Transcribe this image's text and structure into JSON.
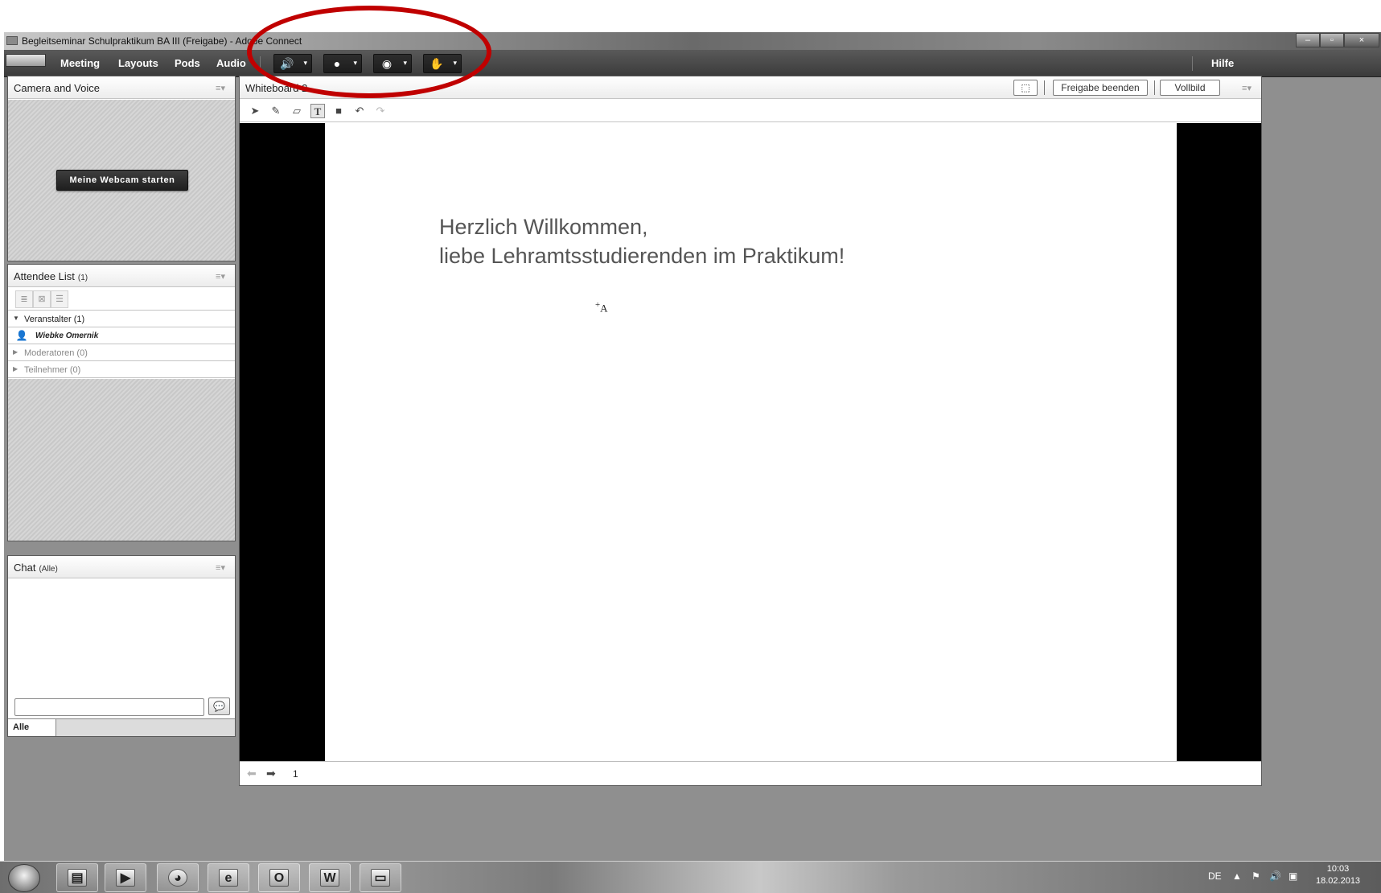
{
  "window": {
    "title": "Begleitseminar Schulpraktikum BA III (Freigabe) - Adobe Connect",
    "controls": [
      "–",
      "▫",
      "×"
    ]
  },
  "menubar": {
    "items": [
      "Meeting",
      "Layouts",
      "Pods",
      "Audio"
    ],
    "help_label": "Hilfe",
    "toolbar_icons": [
      "speaker-icon",
      "microphone-icon",
      "webcam-icon",
      "raise-hand-icon"
    ]
  },
  "camera_pod": {
    "title": "Camera and Voice",
    "start_webcam_label": "Meine Webcam starten"
  },
  "attendee_pod": {
    "title": "Attendee List",
    "count": "(1)",
    "groups": [
      {
        "label": "Veranstalter (1)",
        "expanded": true,
        "members": [
          "Wiebke Omernik"
        ]
      },
      {
        "label": "Moderatoren (0)",
        "expanded": false,
        "members": []
      },
      {
        "label": "Teilnehmer (0)",
        "expanded": false,
        "members": []
      }
    ]
  },
  "chat_pod": {
    "title": "Chat",
    "scope": "(Alle)",
    "input_value": "",
    "tab_label": "Alle"
  },
  "whiteboard_pod": {
    "title": "Whiteboard 2",
    "stop_share_label": "Freigabe beenden",
    "fullscreen_label": "Vollbild",
    "tools": [
      "selection-tool-icon",
      "pencil-tool-icon",
      "eraser-tool-icon",
      "text-tool-icon",
      "shape-tool-icon",
      "undo-icon",
      "redo-icon"
    ],
    "active_tool": "text",
    "slide_lines": [
      "Herzlich Willkommen,",
      "liebe Lehramtsstudierenden im Praktikum!"
    ],
    "text_cursor": "+A",
    "page_number": "1"
  },
  "taskbar": {
    "apps": [
      "explorer-icon",
      "media-player-icon",
      "firefox-icon",
      "internet-explorer-icon",
      "outlook-icon",
      "word-icon",
      "adobe-connect-icon"
    ],
    "language": "DE",
    "time": "10:03",
    "date": "18.02.2013"
  },
  "annotation": {
    "color": "#c00000"
  },
  "colors": {
    "menubar": "#4a4a4a",
    "pod_border": "#5a5a5a",
    "slide_text": "#555555"
  }
}
